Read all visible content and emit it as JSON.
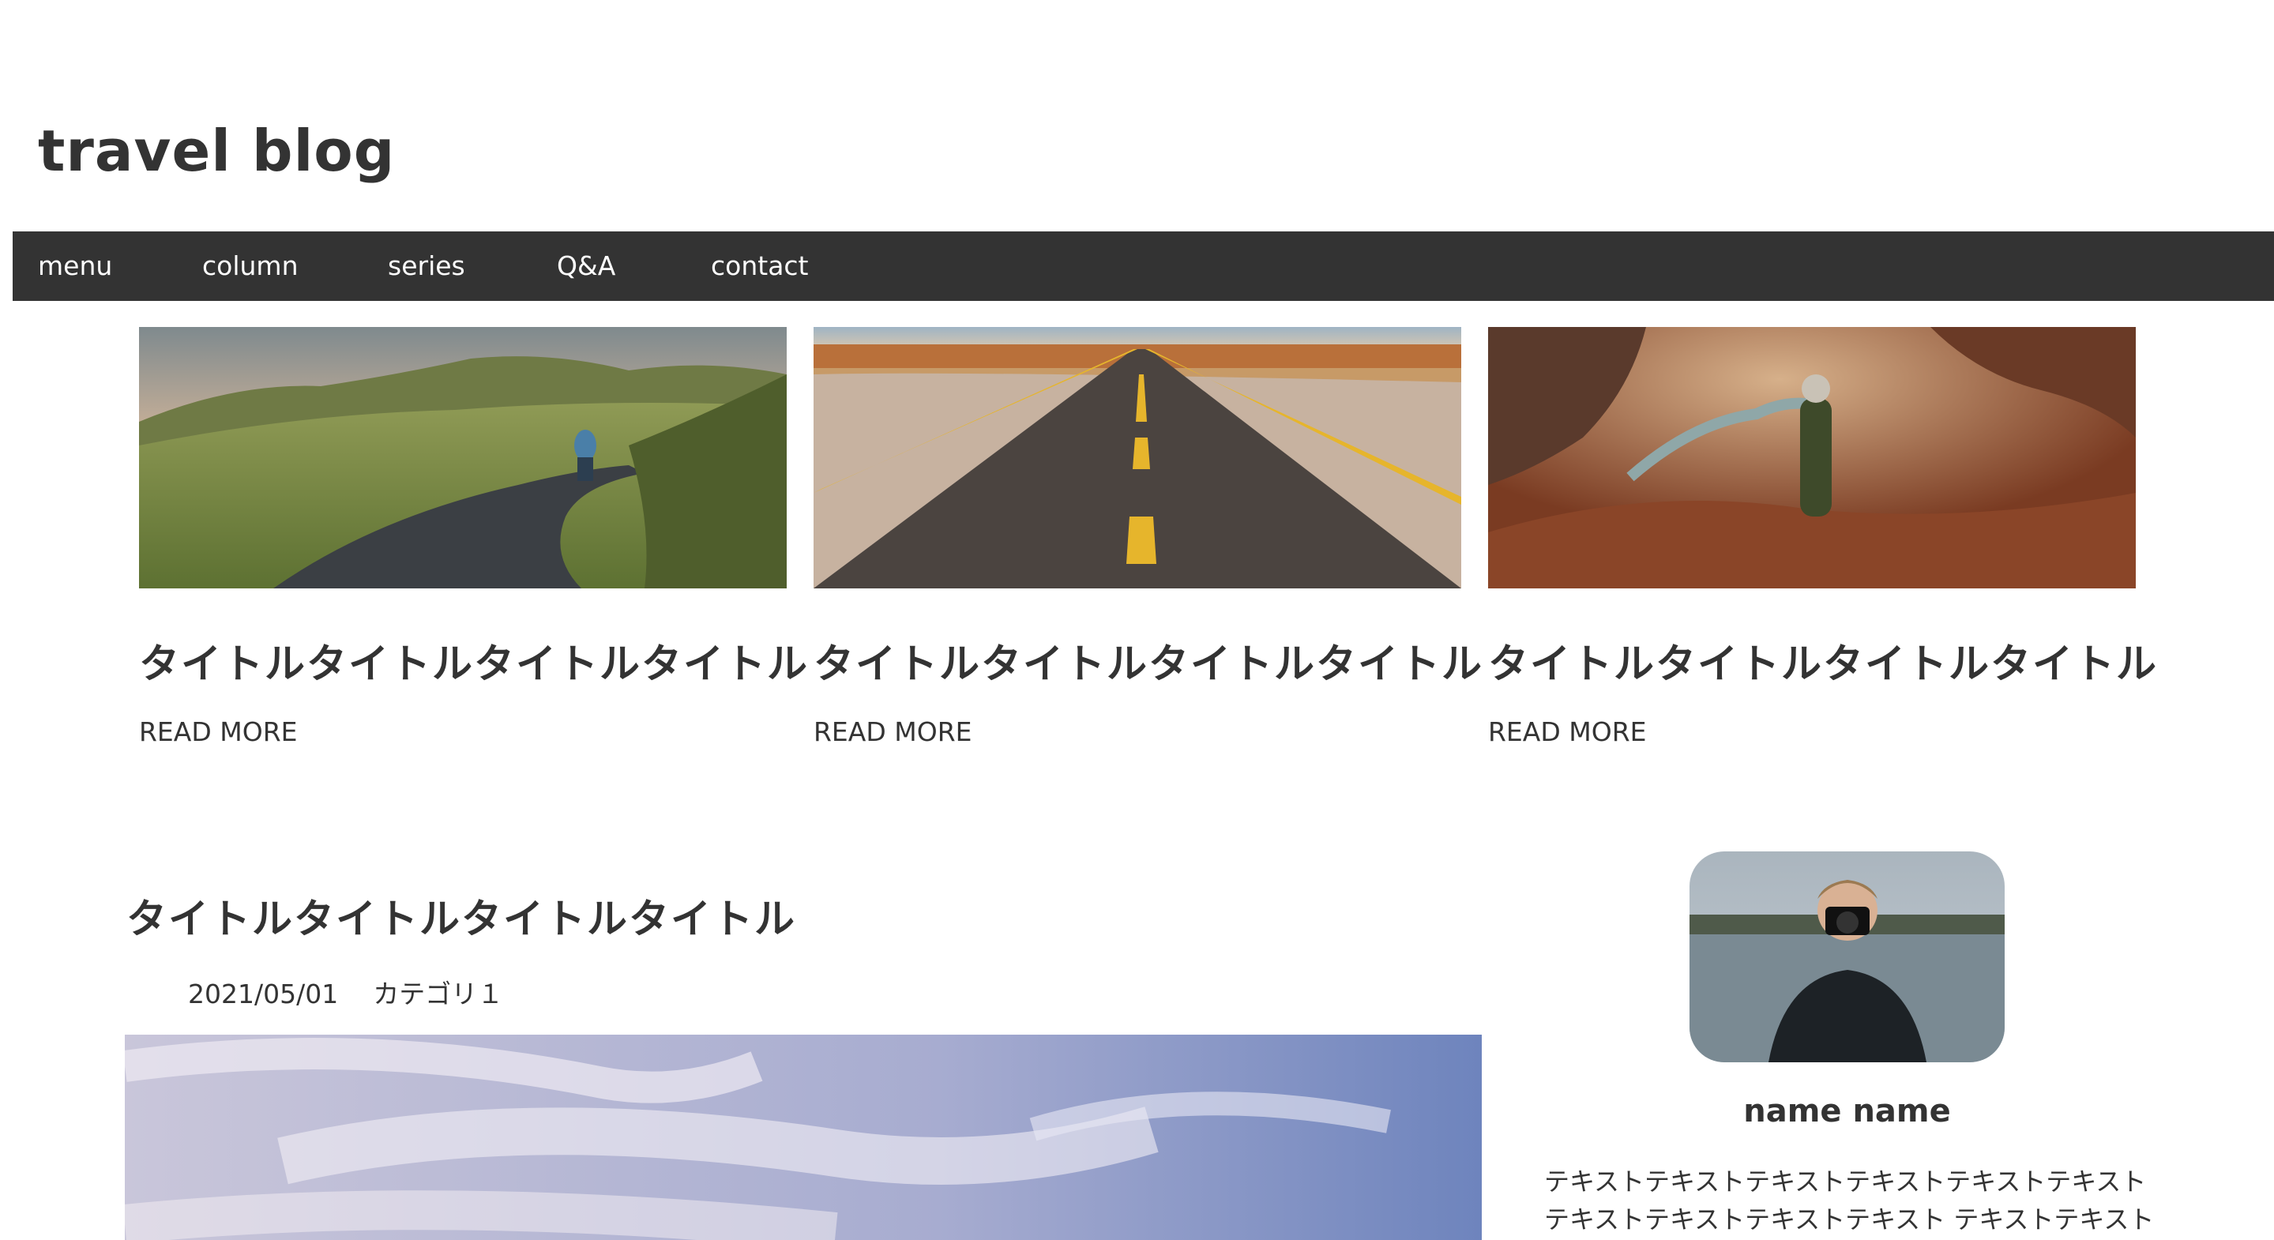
{
  "header": {
    "site_title": "travel blog"
  },
  "nav": {
    "items": [
      {
        "label": "menu"
      },
      {
        "label": "column"
      },
      {
        "label": "series"
      },
      {
        "label": "Q&A"
      },
      {
        "label": "contact"
      }
    ]
  },
  "cards": [
    {
      "title": "タイトルタイトルタイトルタイトル",
      "more": "READ MORE",
      "image": "cyclist-on-hill-road-photo"
    },
    {
      "title": "タイトルタイトルタイトルタイトル",
      "more": "READ MORE",
      "image": "desert-highway-photo"
    },
    {
      "title": "タイトルタイトルタイトルタイトル",
      "more": "READ MORE",
      "image": "canyon-hiker-photo"
    }
  ],
  "post": {
    "title": "タイトルタイトルタイトルタイトル",
    "date": "2021/05/01",
    "category": "カテゴリ１",
    "image": "sky-clouds-photo"
  },
  "profile": {
    "name": "name name",
    "text_lines": [
      "テキストテキストテキストテキストテキストテキスト",
      "テキストテキストテキストテキスト テキストテキスト"
    ],
    "image": "photographer-avatar-photo"
  },
  "colors": {
    "nav_bg": "#333333",
    "text": "#333333",
    "nav_text": "#ffffff"
  }
}
